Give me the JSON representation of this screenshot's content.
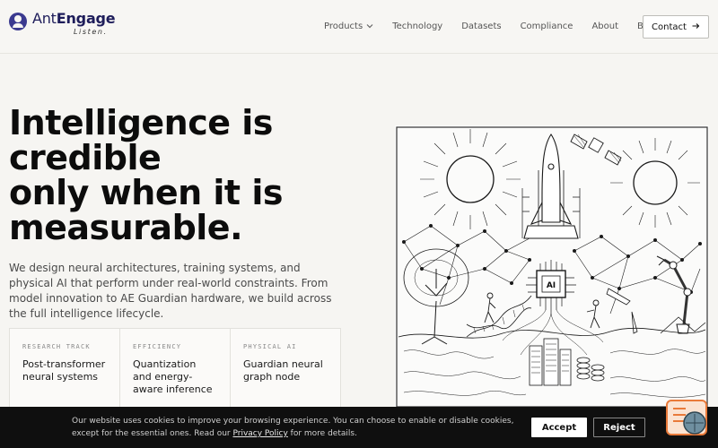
{
  "brand": {
    "name_part1": "Ant",
    "name_part2": "Engage",
    "tagline": "Listen."
  },
  "nav": {
    "items": [
      {
        "label": "Products",
        "has_dropdown": true
      },
      {
        "label": "Technology"
      },
      {
        "label": "Datasets"
      },
      {
        "label": "Compliance"
      },
      {
        "label": "About"
      },
      {
        "label": "Blog"
      }
    ],
    "contact_label": "Contact",
    "contact_icon": "arrow-right-icon"
  },
  "hero": {
    "headline_lines": [
      "Intelligence is",
      "credible",
      "only when it is",
      "measurable."
    ],
    "subtext": "We design neural architectures, training systems, and physical AI that perform under real-world constraints. From model innovation to AE Guardian hardware, we build across the full intelligence lifecycle."
  },
  "cards": [
    {
      "eyebrow": "RESEARCH TRACK",
      "title": "Post-transformer neural systems"
    },
    {
      "eyebrow": "EFFICIENCY",
      "title": "Quantization and energy-aware inference"
    },
    {
      "eyebrow": "PHYSICAL AI",
      "title": "Guardian neural graph node"
    }
  ],
  "illustration": {
    "chip_label": "AI",
    "icons": [
      "sun-icon",
      "rocket-icon",
      "satellite-icon",
      "tree-icon",
      "dna-icon",
      "robot-arm-icon",
      "city-icon",
      "network-icon"
    ]
  },
  "cookie_banner": {
    "text_before_link": "Our website uses cookies to improve your browsing experience. You can choose to enable or disable cookies, except for the essential ones. Read our ",
    "link_text": "Privacy Policy",
    "text_after_link": " for more details.",
    "accept_label": "Accept",
    "reject_label": "Reject"
  },
  "colors": {
    "brand": "#3b3a8f",
    "background": "#f6f5f2",
    "banner": "#0f0f0f",
    "chat_widget": "#e97a3a"
  }
}
